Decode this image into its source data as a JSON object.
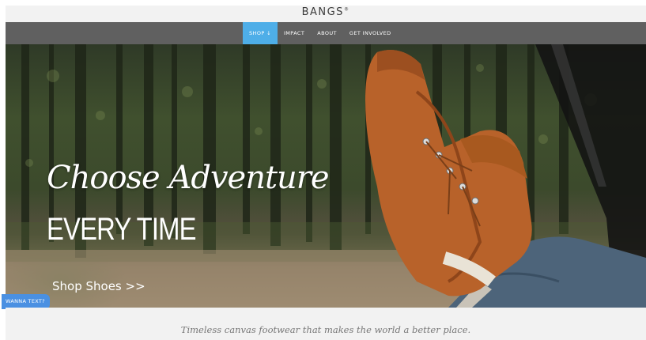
{
  "header": {
    "logo": "BANGS",
    "logo_mark": "®"
  },
  "nav": {
    "items": [
      {
        "label": "SHOP ↓",
        "active": true
      },
      {
        "label": "IMPACT",
        "active": false
      },
      {
        "label": "ABOUT",
        "active": false
      },
      {
        "label": "GET INVOLVED",
        "active": false
      }
    ]
  },
  "hero": {
    "title_script": "Choose Adventure",
    "title_caps": "EVERY TIME",
    "cta": "Shop Shoes >>"
  },
  "chat": {
    "label": "WANNA TEXT?"
  },
  "tagline": "Timeless canvas footwear that makes the world a better place.",
  "colors": {
    "nav_bg": "#606060",
    "nav_active": "#4eaee8",
    "chat_bg": "#4a90e2",
    "shoe": "#b8622a"
  }
}
